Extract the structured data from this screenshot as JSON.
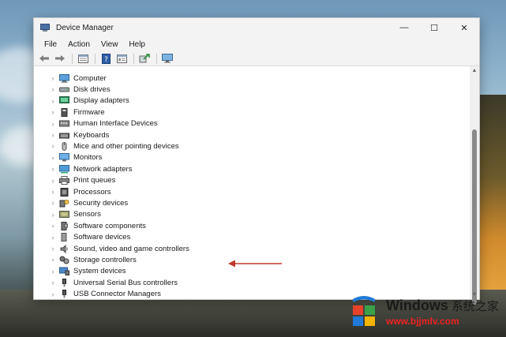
{
  "window": {
    "title": "Device Manager",
    "controls": {
      "minimize": "—",
      "maximize": "☐",
      "close": "✕"
    }
  },
  "menu": [
    "File",
    "Action",
    "View",
    "Help"
  ],
  "toolbar": [
    {
      "icon": "back-arrow-icon"
    },
    {
      "icon": "forward-arrow-icon"
    },
    {
      "icon": "properties-sheet-icon"
    },
    {
      "icon": "help-icon"
    },
    {
      "icon": "view-list-icon"
    },
    {
      "icon": "scan-hardware-icon"
    },
    {
      "icon": "monitor-icon"
    }
  ],
  "tree": {
    "expander": "›",
    "items": [
      {
        "label": "Computer",
        "icon": "computer-icon"
      },
      {
        "label": "Disk drives",
        "icon": "disk-drive-icon"
      },
      {
        "label": "Display adapters",
        "icon": "display-adapter-icon"
      },
      {
        "label": "Firmware",
        "icon": "firmware-icon"
      },
      {
        "label": "Human Interface Devices",
        "icon": "hid-icon"
      },
      {
        "label": "Keyboards",
        "icon": "keyboard-icon"
      },
      {
        "label": "Mice and other pointing devices",
        "icon": "mouse-icon"
      },
      {
        "label": "Monitors",
        "icon": "monitor-icon"
      },
      {
        "label": "Network adapters",
        "icon": "network-adapter-icon"
      },
      {
        "label": "Print queues",
        "icon": "printer-icon"
      },
      {
        "label": "Processors",
        "icon": "processor-icon"
      },
      {
        "label": "Security devices",
        "icon": "security-device-icon"
      },
      {
        "label": "Sensors",
        "icon": "sensor-icon"
      },
      {
        "label": "Software components",
        "icon": "software-component-icon"
      },
      {
        "label": "Software devices",
        "icon": "software-device-icon"
      },
      {
        "label": "Sound, video and game controllers",
        "icon": "speaker-icon"
      },
      {
        "label": "Storage controllers",
        "icon": "storage-controller-icon"
      },
      {
        "label": "System devices",
        "icon": "system-device-icon"
      },
      {
        "label": "Universal Serial Bus controllers",
        "icon": "usb-icon"
      },
      {
        "label": "USB Connector Managers",
        "icon": "usb-icon"
      }
    ]
  },
  "annotation": {
    "color": "#c0392b"
  },
  "watermark": {
    "brand": "Windows",
    "brand_cn": "系统之家",
    "url": "www.bjjmlv.com",
    "logo_colors": [
      "#e8412b",
      "#3aa14a",
      "#1f7ad6",
      "#f4b400"
    ]
  }
}
